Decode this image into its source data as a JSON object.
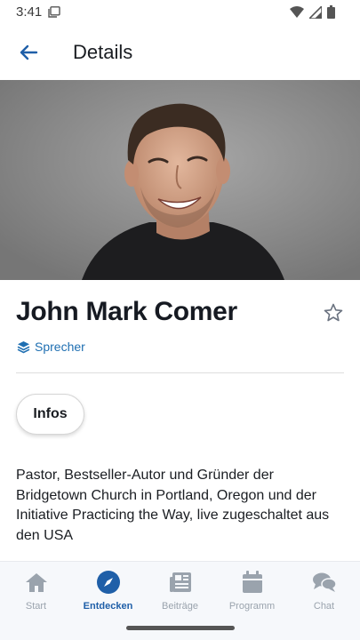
{
  "status_bar": {
    "time": "3:41",
    "icons": [
      "notification-icon",
      "wifi-icon",
      "signal-icon",
      "battery-icon"
    ]
  },
  "app_bar": {
    "title": "Details",
    "back_icon": "arrow-left-icon"
  },
  "speaker": {
    "name": "John Mark Comer",
    "tag": "Sprecher",
    "tag_icon": "layers-icon",
    "favorite_icon": "star-outline-icon",
    "photo_icon": "speaker-portrait"
  },
  "tabs": {
    "infos_label": "Infos"
  },
  "description": "Pastor, Bestseller-Autor und Gründer der Bridgetown Church in Portland, Oregon und der Initiative Practicing the Way, live zugeschaltet aus den USA",
  "bottom_nav": {
    "items": [
      {
        "label": "Start",
        "icon": "home-icon",
        "active": false
      },
      {
        "label": "Entdecken",
        "icon": "compass-icon",
        "active": true
      },
      {
        "label": "Beiträge",
        "icon": "newspaper-icon",
        "active": false
      },
      {
        "label": "Programm",
        "icon": "calendar-icon",
        "active": false
      },
      {
        "label": "Chat",
        "icon": "chat-bubbles-icon",
        "active": false
      }
    ]
  },
  "colors": {
    "accent": "#1f5fa8",
    "tag": "#1f6fb2",
    "inactive": "#9aa3ad",
    "text": "#1a1d22"
  }
}
